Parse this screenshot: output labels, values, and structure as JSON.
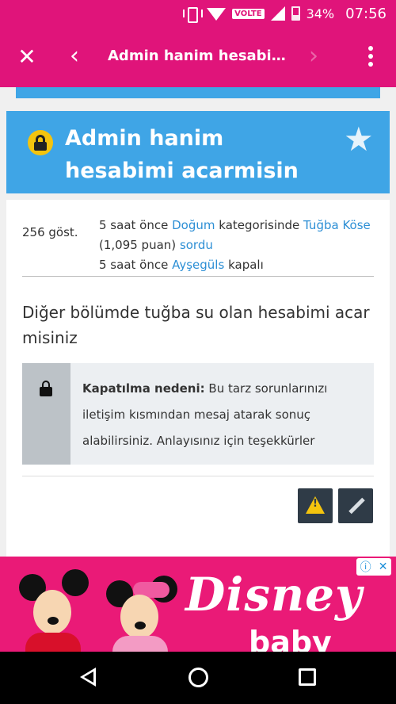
{
  "status_bar": {
    "network": "VOLTE",
    "battery": "34%",
    "time": "07:56"
  },
  "app_bar": {
    "title": "Admin hanim hesabimi a..."
  },
  "question": {
    "title": "Admin hanim hesabimi acarmisin",
    "views": "256 göst.",
    "line1": {
      "time": "5 saat önce",
      "category": "Doğum",
      "category_suffix": "kategorisinde",
      "user": "Tuğba Köse"
    },
    "line2": {
      "points": "(1,095 puan)",
      "action": "sordu"
    },
    "line3": {
      "time": "5 saat önce",
      "user": "Ayşegüls",
      "status": "kapalı"
    },
    "body": "Diğer bölümde tuğba su olan hesabimi acar misiniz",
    "closed_reason": {
      "label": "Kapatılma nedeni:",
      "text": "Bu tarz sorunlarınızı iletişim kısmından mesaj atarak sonuç alabilirsiniz. Anlayısınız için teşekkürler"
    }
  },
  "ad": {
    "brand": "Disney",
    "sub": "baby",
    "info_icon": "ⓘ",
    "close_icon": "✕"
  },
  "colors": {
    "brand": "#e0147a",
    "title_box": "#3fa5e6",
    "link": "#2d8fd5",
    "lock": "#f4c40e"
  }
}
